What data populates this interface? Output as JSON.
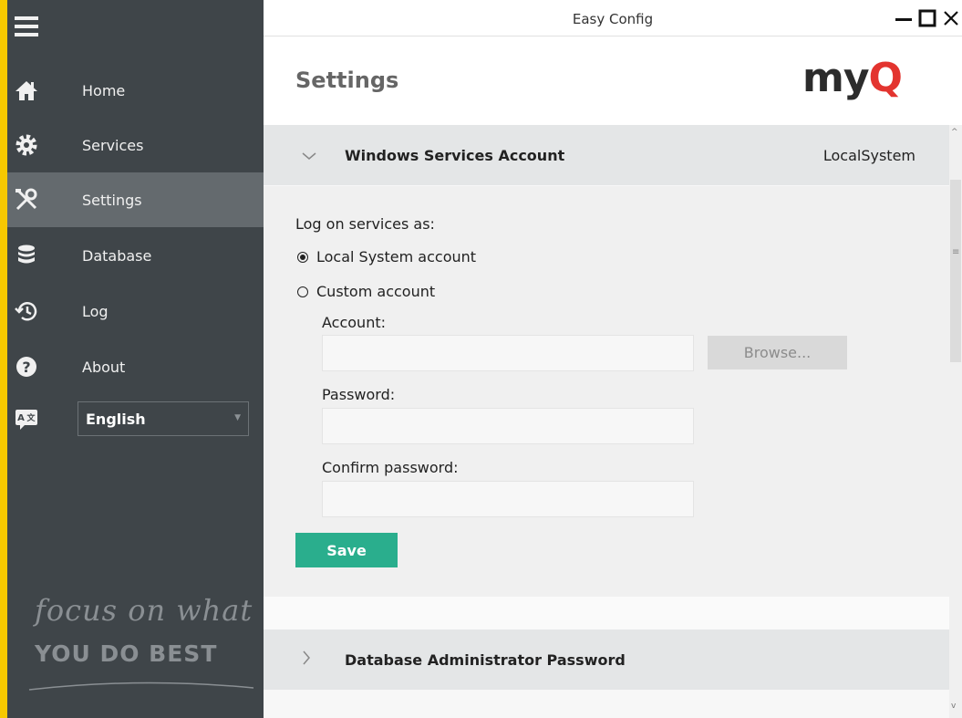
{
  "window": {
    "title": "Easy Config",
    "minimize_icon": "minimize-icon",
    "maximize_icon": "maximize-icon",
    "close_icon": "close-icon"
  },
  "sidebar": {
    "menu_icon": "hamburger-menu-icon",
    "items": [
      {
        "label": "Home",
        "icon": "home-icon",
        "active": false
      },
      {
        "label": "Services",
        "icon": "gear-icon",
        "active": false
      },
      {
        "label": "Settings",
        "icon": "tools-icon",
        "active": true
      },
      {
        "label": "Database",
        "icon": "database-icon",
        "active": false
      },
      {
        "label": "Log",
        "icon": "history-icon",
        "active": false
      },
      {
        "label": "About",
        "icon": "question-icon",
        "active": false
      }
    ],
    "language": {
      "icon": "translate-icon",
      "selected": "English"
    },
    "tagline": {
      "line1": "focus on what",
      "line2": "YOU DO BEST"
    },
    "background": "#3f4549",
    "active_background": "#646a6e"
  },
  "header": {
    "title": "Settings",
    "logo": {
      "prefix": "my",
      "accent": "Q",
      "accent_color": "#e3342f"
    }
  },
  "sections": [
    {
      "title": "Windows Services Account",
      "value": "LocalSystem",
      "expanded": true,
      "content": {
        "log_on_label": "Log on services as:",
        "options": [
          {
            "label": "Local System account",
            "selected": true
          },
          {
            "label": "Custom account",
            "selected": false
          }
        ],
        "account_label": "Account:",
        "account_value": "",
        "browse_label": "Browse...",
        "password_label": "Password:",
        "password_value": "",
        "confirm_label": "Confirm password:",
        "confirm_value": "",
        "save_label": "Save",
        "save_color": "#2aae8d"
      }
    },
    {
      "title": "Database Administrator Password",
      "value": "",
      "expanded": false
    }
  ]
}
